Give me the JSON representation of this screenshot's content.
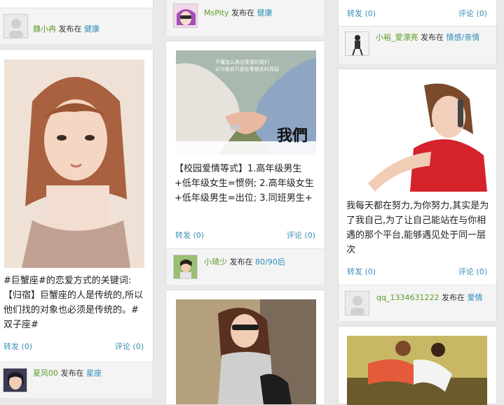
{
  "col1": {
    "top_footer": {
      "user": "魏小冉",
      "posted_in": "发布在",
      "category": "健康"
    },
    "post": {
      "caption": "#巨蟹座#的恋爱方式的关键词:【归宿】巨蟹座的人是传统的,所以他们找的对象也必须是传统的。#双子座#",
      "forward_label": "转发",
      "forward_count": "(0)",
      "comment_label": "评论",
      "comment_count": "(0)",
      "user": "夏风00",
      "posted_in": "发布在",
      "category": "星座"
    }
  },
  "col2": {
    "top_footer": {
      "user": "MsPity",
      "posted_in": "发布在",
      "category": "健康"
    },
    "post": {
      "image_text_top": "不懂怎么表达爱意的我们\n以为彼此只是在看彼此的背后",
      "image_text_brand": "我們",
      "caption": "【校园爱情等式】1.高年级男生+低年级女生=惯例; 2.高年级女生+低年级男生=出位; 3.同班男生+",
      "forward_label": "转发",
      "forward_count": "(0)",
      "comment_label": "评论",
      "comment_count": "(0)",
      "user": "小琦少",
      "posted_in": "发布在",
      "category": "80/90后"
    }
  },
  "col3": {
    "top": {
      "forward_label": "转发",
      "forward_count": "(0)",
      "comment_label": "评论",
      "comment_count": "(0)",
      "user": "小裕_爱漂亮",
      "posted_in": "发布在",
      "category": "情感/亲情"
    },
    "post": {
      "caption": "我每天都在努力,为你努力,其实是为了我自己,为了让自己能站在与你相遇的那个平台,能够遇见处于同一层次",
      "forward_label": "转发",
      "forward_count": "(0)",
      "comment_label": "评论",
      "comment_count": "(0)",
      "user": "qq_1334631222",
      "posted_in": "发布在",
      "category": "爱情"
    }
  }
}
